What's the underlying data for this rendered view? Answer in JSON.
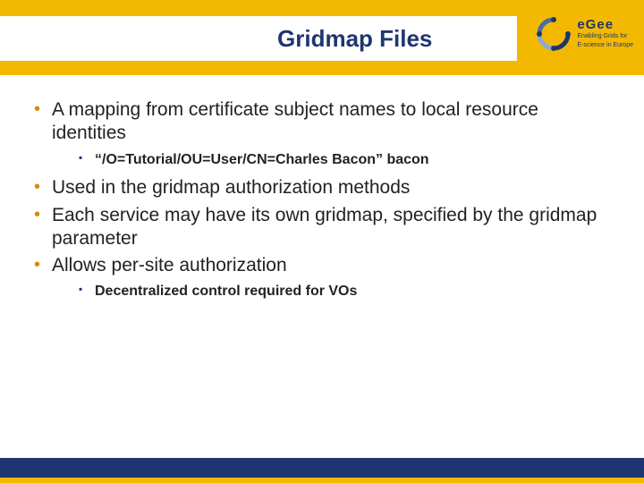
{
  "header": {
    "title": "Gridmap Files",
    "logo": {
      "acronym": "eGee",
      "tagline_line1": "Enabling Grids for",
      "tagline_line2": "E-science in Europe"
    }
  },
  "bullets": {
    "b1": "A mapping from certificate subject names to local resource identities",
    "b1_sub1": "“/O=Tutorial/OU=User/CN=Charles Bacon” bacon",
    "b2": "Used in the gridmap authorization methods",
    "b3": "Each service may have its own gridmap, specified by the gridmap parameter",
    "b4": "Allows per-site authorization",
    "b4_sub1": "Decentralized control required for VOs"
  },
  "colors": {
    "accent_yellow": "#f3b900",
    "accent_blue": "#1e3570",
    "bullet_orange": "#d68c00"
  }
}
